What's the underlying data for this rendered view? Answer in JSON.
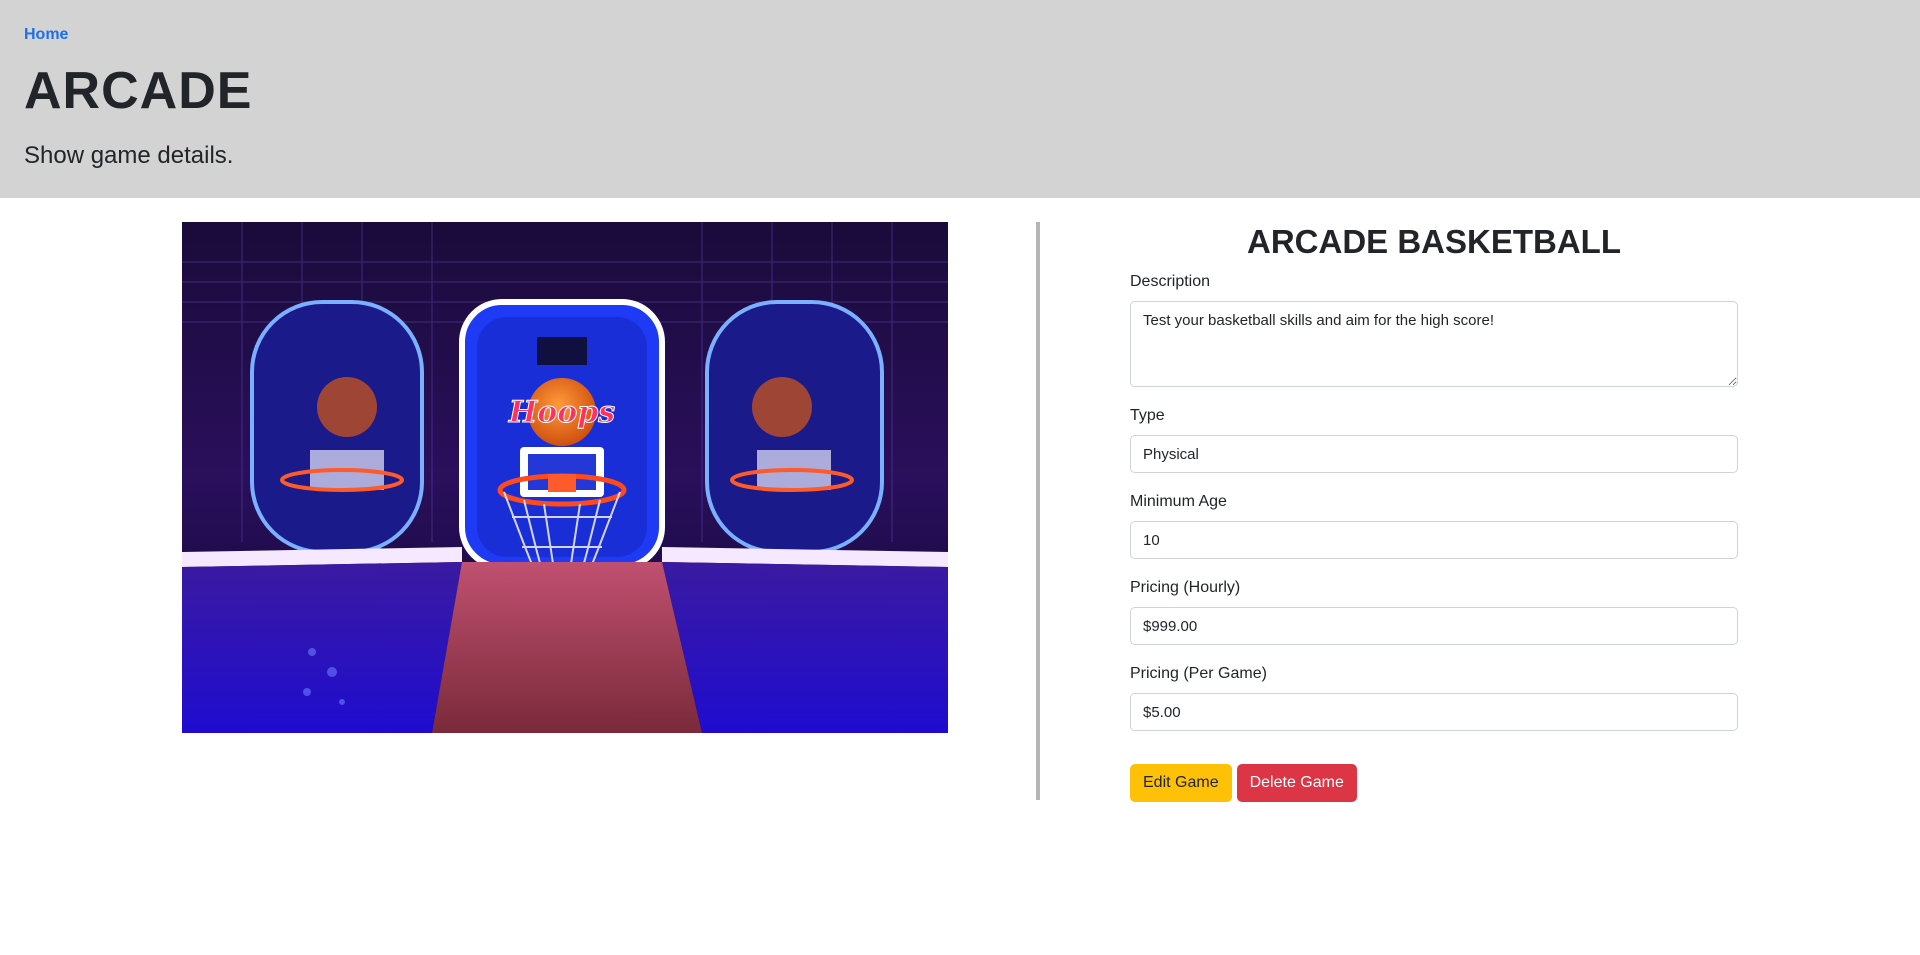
{
  "header": {
    "home_link": "Home",
    "title": "ARCADE",
    "subtitle": "Show game details."
  },
  "game": {
    "title": "ARCADE BASKETBALL",
    "image_icon": "arcade-basketball-image",
    "fields": {
      "description": {
        "label": "Description",
        "value": "Test your basketball skills and aim for the high score!"
      },
      "type": {
        "label": "Type",
        "value": "Physical"
      },
      "min_age": {
        "label": "Minimum Age",
        "value": "10"
      },
      "pricing_hourly": {
        "label": "Pricing (Hourly)",
        "value": "$999.00"
      },
      "pricing_per_game": {
        "label": "Pricing (Per Game)",
        "value": "$5.00"
      }
    }
  },
  "actions": {
    "edit_label": "Edit Game",
    "delete_label": "Delete Game"
  },
  "colors": {
    "header_bg": "#d3d3d3",
    "link": "#1e6fe8",
    "edit_button": "#ffc107",
    "delete_button": "#dc3545",
    "divider": "#b5b5b5"
  }
}
